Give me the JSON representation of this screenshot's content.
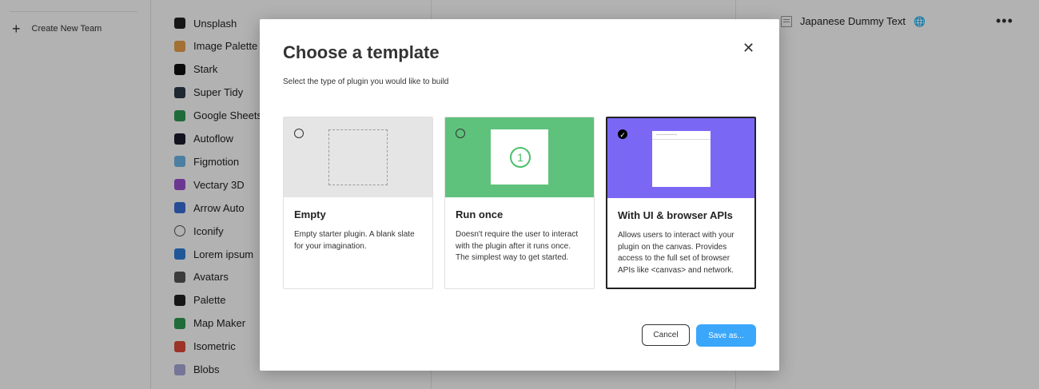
{
  "sidebar": {
    "create_team_label": "Create New Team"
  },
  "plugins": [
    {
      "label": "Unsplash",
      "icon": "unsplash-icon",
      "color": "#222222"
    },
    {
      "label": "Image Palette",
      "icon": "palette-dots-icon",
      "color": "#e8a24a"
    },
    {
      "label": "Stark",
      "icon": "stark-icon",
      "color": "#111111"
    },
    {
      "label": "Super Tidy",
      "icon": "super-tidy-icon",
      "color": "#2a3a4a"
    },
    {
      "label": "Google Sheets",
      "icon": "google-sheets-icon",
      "color": "#2e9a52"
    },
    {
      "label": "Autoflow",
      "icon": "autoflow-icon",
      "color": "#1c1c2e"
    },
    {
      "label": "Figmotion",
      "icon": "figmotion-icon",
      "color": "#6fb6e8"
    },
    {
      "label": "Vectary 3D",
      "icon": "vectary-icon",
      "color": "#9a4fd0"
    },
    {
      "label": "Arrow Auto",
      "icon": "arrow-auto-icon",
      "color": "#3a6fd8"
    },
    {
      "label": "Iconify",
      "icon": "iconify-icon",
      "color": "#ffffff"
    },
    {
      "label": "Lorem ipsum",
      "icon": "lorem-ipsum-icon",
      "color": "#2f7fd8"
    },
    {
      "label": "Avatars",
      "icon": "avatars-icon",
      "color": "#555555"
    },
    {
      "label": "Palette",
      "icon": "palette-icon",
      "color": "#222222"
    },
    {
      "label": "Map Maker",
      "icon": "map-maker-icon",
      "color": "#2e9a52"
    },
    {
      "label": "Isometric",
      "icon": "isometric-icon",
      "color": "#e04a3a"
    },
    {
      "label": "Blobs",
      "icon": "blobs-icon",
      "color": "#a8a8d8"
    }
  ],
  "right_panel": {
    "item_label": "Japanese Dummy Text"
  },
  "modal": {
    "title": "Choose a template",
    "subtitle": "Select the type of plugin you would like to build",
    "cards": [
      {
        "title": "Empty",
        "description": "Empty starter plugin. A blank slate for your imagination.",
        "thumb_color": "#e5e5e5",
        "selected": false
      },
      {
        "title": "Run once",
        "description": "Doesn't require the user to interact with the plugin after it runs once. The simplest way to get started.",
        "thumb_color": "#5ec27c",
        "number": "1",
        "selected": false
      },
      {
        "title": "With UI & browser APIs",
        "description": "Allows users to interact with your plugin on the canvas. Provides access to the full set of browser APIs like <canvas> and network.",
        "thumb_color": "#7a68f5",
        "selected": true
      }
    ],
    "cancel_label": "Cancel",
    "save_label": "Save as..."
  }
}
